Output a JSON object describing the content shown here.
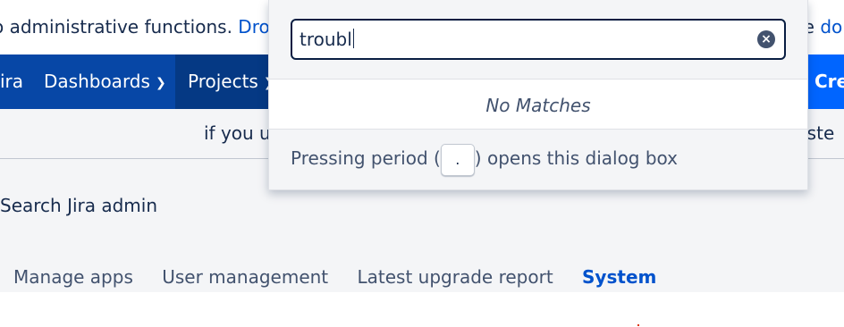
{
  "banner": {
    "text_before": "o administrative functions. ",
    "link": "Drop a",
    "right_text": "he ",
    "right_link": "do"
  },
  "nav": {
    "brand": "ira",
    "dashboards": "Dashboards",
    "projects": "Projects",
    "create": "Cre"
  },
  "info": {
    "left": "if you us",
    "right": "nste"
  },
  "admin": {
    "search_label": "Search Jira admin",
    "tabs": [
      "Manage apps",
      "User management",
      "Latest upgrade report",
      "System"
    ],
    "selected_tab": "System"
  },
  "dialog": {
    "search_value": "troubl",
    "clear_icon": "×",
    "no_matches": "No Matches",
    "hint_before": "Pressing period (",
    "hint_key": ".",
    "hint_after": ") opens this dialog box"
  },
  "colors": {
    "nav_bg": "#0747a6",
    "nav_active": "#053984",
    "create_bg": "#0065ff",
    "link": "#0052cc"
  }
}
